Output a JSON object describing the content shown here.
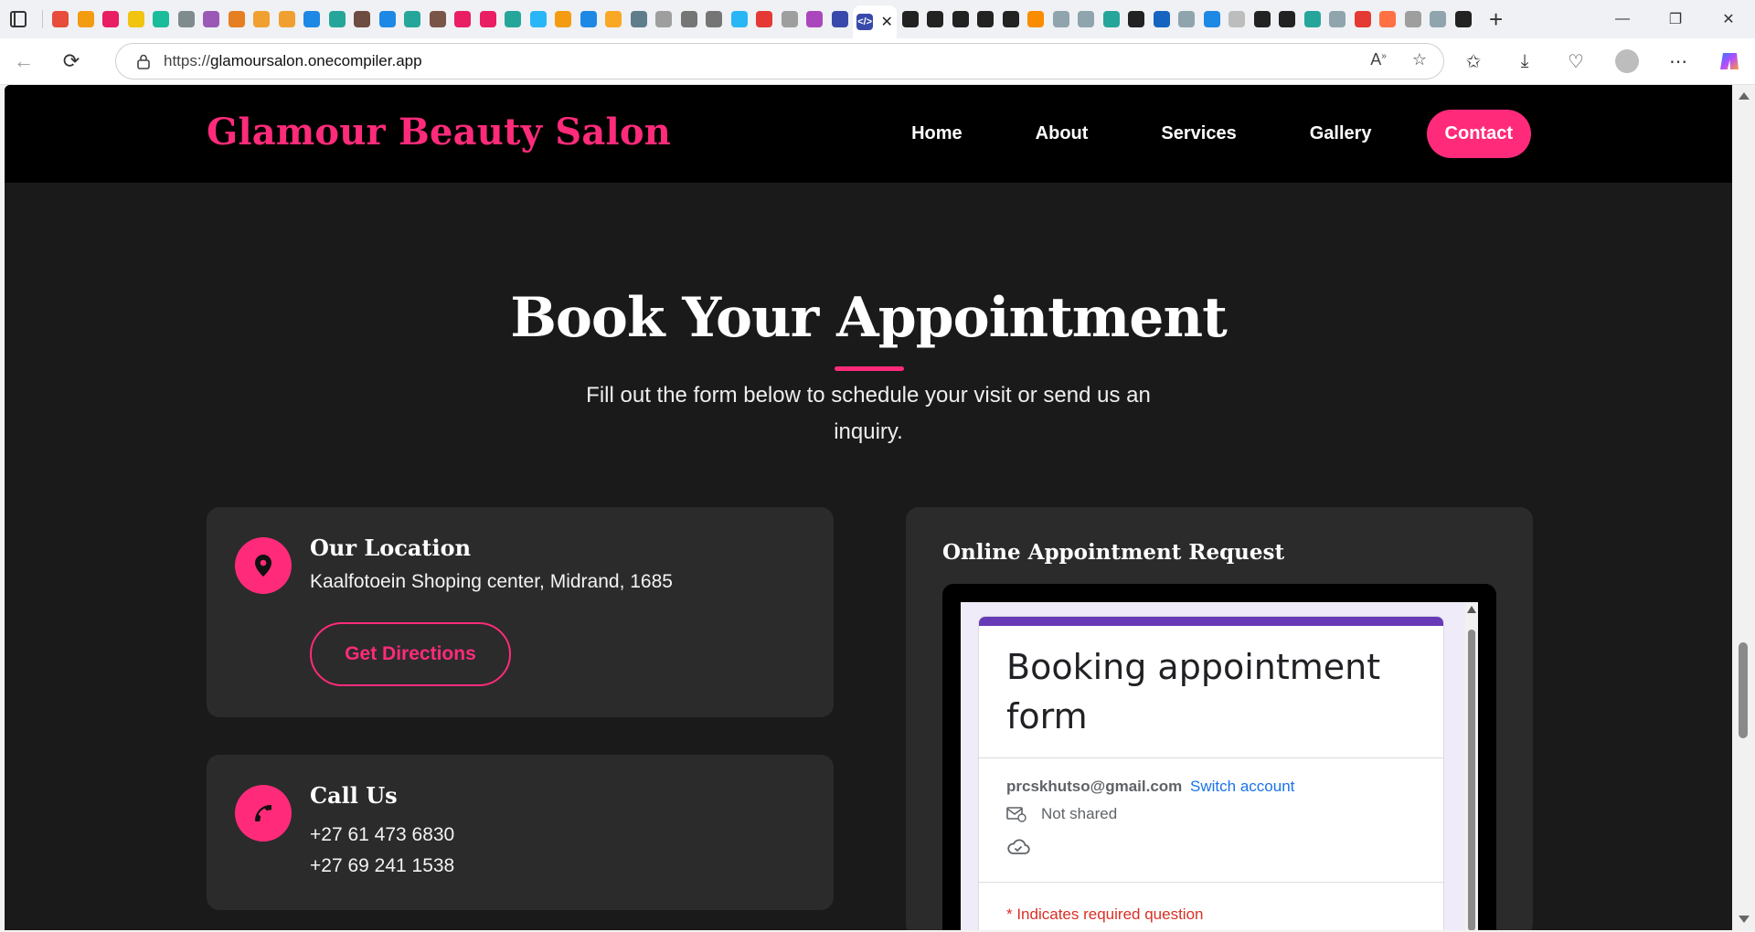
{
  "browser": {
    "url_prefix": "https://",
    "url_host": "glamoursalon.onecompiler.app",
    "tab_favicon_colors": [
      "#e74c3c",
      "#f39c12",
      "#e91e63",
      "#f1c40f",
      "#1abc9c",
      "#7f8c8d",
      "#9b59b6",
      "#e67e22",
      "#f0a030",
      "#f0a030",
      "#1e88e5",
      "#26a69a",
      "#6d4c41",
      "#1e88e5",
      "#26a69a",
      "#795548",
      "#e91e63",
      "#e91e63",
      "#26a69a",
      "#29b6f6",
      "#f39c12",
      "#1e88e5",
      "#f9a825",
      "#607d8b",
      "#9e9e9e",
      "#757575",
      "#757575",
      "#29b6f6",
      "#e53935",
      "#9e9e9e",
      "#ab47bc",
      "#3949ab"
    ],
    "right_tab_favicon_colors": [
      "#222",
      "#222",
      "#222",
      "#222",
      "#222",
      "#fb8c00",
      "#90a4ae",
      "#90a4ae",
      "#26a69a",
      "#222",
      "#1565c0",
      "#90a4ae",
      "#1e88e5",
      "#bdbdbd",
      "#222",
      "#222",
      "#26a69a",
      "#90a4ae",
      "#e53935",
      "#ff7043",
      "#9e9e9e",
      "#90a4ae",
      "#222"
    ]
  },
  "site": {
    "brand": "Glamour Beauty Salon",
    "accent_color": "#ff2b7a",
    "nav": [
      "Home",
      "About",
      "Services",
      "Gallery",
      "Contact"
    ]
  },
  "section": {
    "title": "Book Your Appointment",
    "subtitle": "Fill out the form below to schedule your visit or send us an inquiry."
  },
  "location_card": {
    "heading": "Our Location",
    "address": "Kaalfotoein Shoping center, Midrand, 1685",
    "button": "Get Directions"
  },
  "call_card": {
    "heading": "Call Us",
    "phone1": "+27 61 473 6830",
    "phone2": "+27 69 241 1538"
  },
  "form_card": {
    "heading": "Online Appointment Request",
    "embedded_form": {
      "title": "Booking appointment form",
      "account_email": "prcskhutso@gmail.com",
      "switch_account": "Switch account",
      "not_shared": "Not shared",
      "required_note": "* Indicates required question"
    }
  }
}
